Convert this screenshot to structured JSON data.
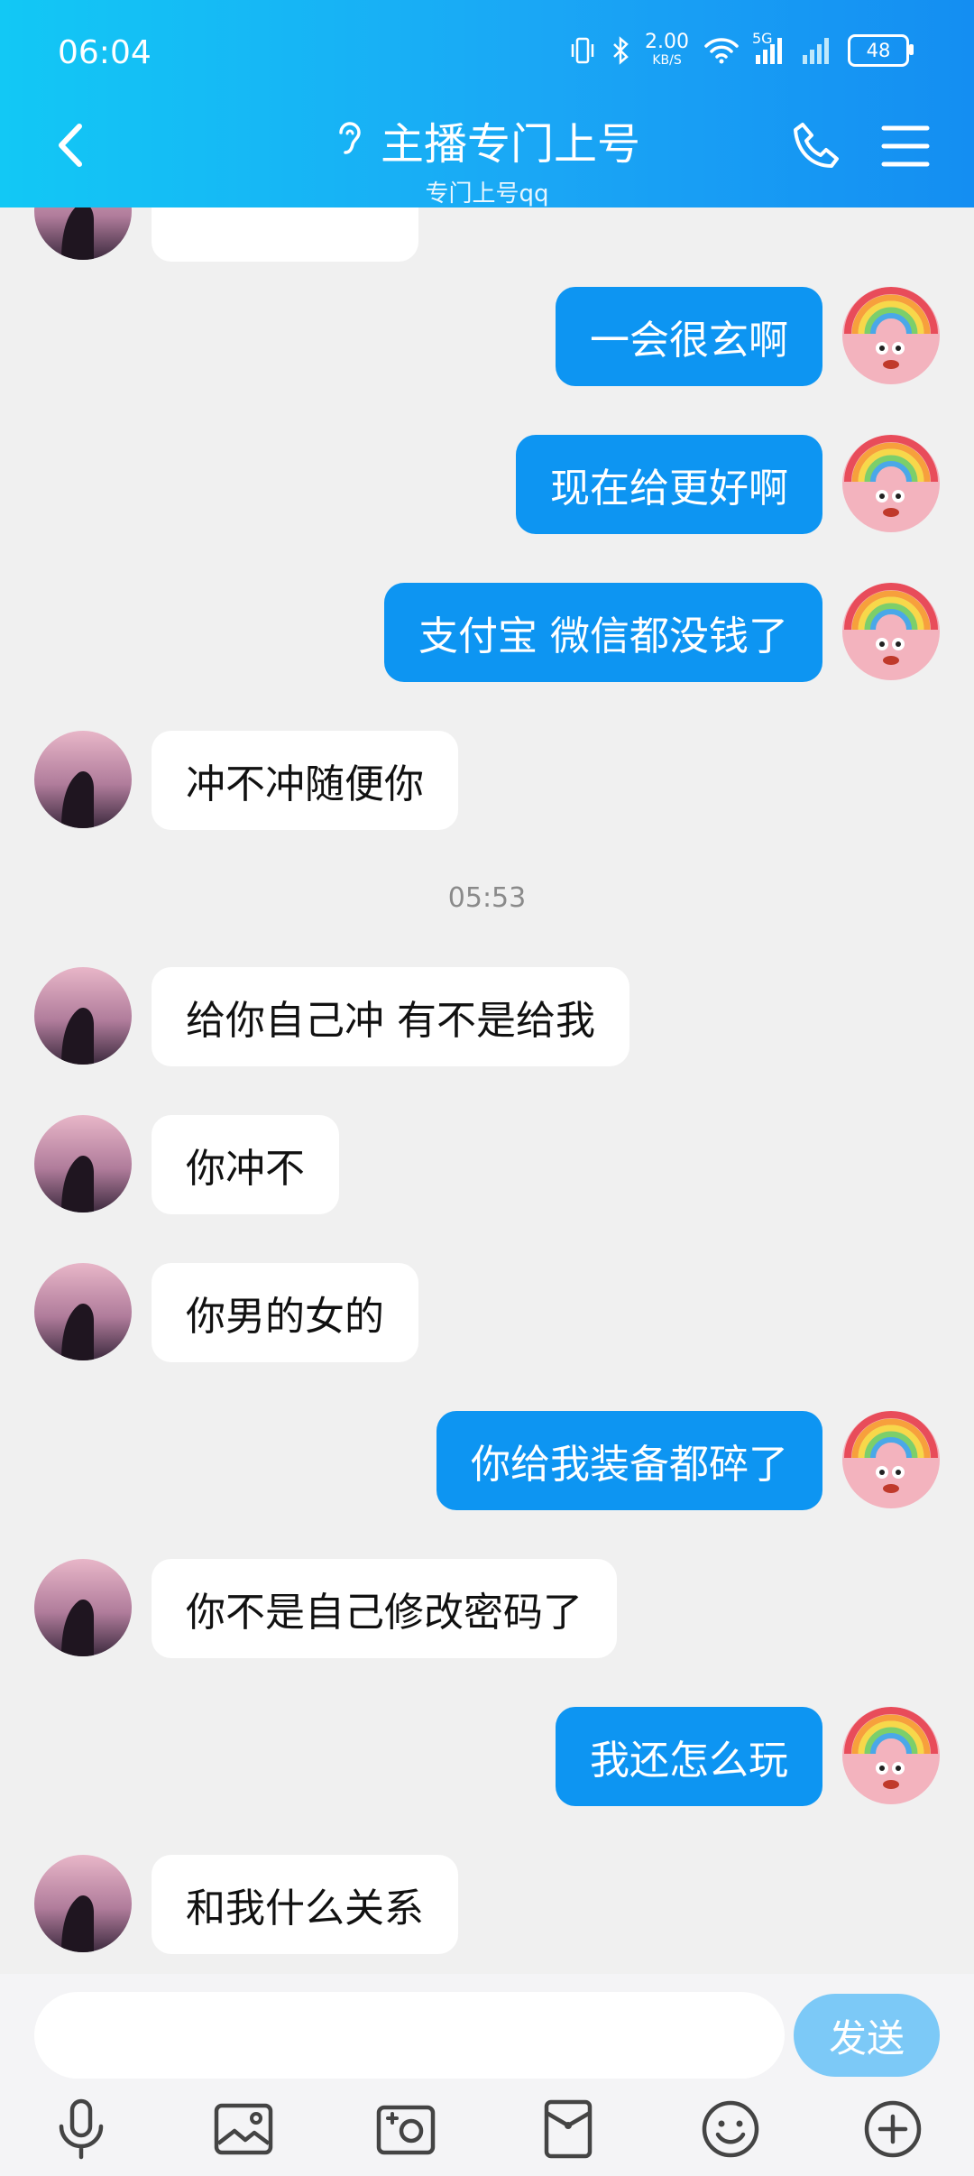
{
  "status": {
    "time": "06:04",
    "speed_value": "2.00",
    "speed_unit": "KB/S",
    "network": "5G",
    "battery": "48"
  },
  "header": {
    "title": "主播专门上号",
    "subtitle": "专门上号qq"
  },
  "messages": [
    {
      "side": "left",
      "text": "",
      "partial": true
    },
    {
      "side": "right",
      "text": "一会很玄啊"
    },
    {
      "side": "right",
      "text": "现在给更好啊"
    },
    {
      "side": "right",
      "text": "支付宝 微信都没钱了"
    },
    {
      "side": "left",
      "text": "冲不冲随便你"
    },
    {
      "side": "left",
      "text": "给你自己冲 有不是给我"
    },
    {
      "side": "left",
      "text": "你冲不"
    },
    {
      "side": "left",
      "text": "你男的女的"
    },
    {
      "side": "right",
      "text": "你给我装备都碎了"
    },
    {
      "side": "left",
      "text": "你不是自己修改密码了"
    },
    {
      "side": "right",
      "text": "我还怎么玩"
    },
    {
      "side": "left",
      "text": "和我什么关系"
    }
  ],
  "time_divider": "05:53",
  "input": {
    "send_label": "发送"
  },
  "toolbar": [
    "microphone-icon",
    "image-icon",
    "camera-icon",
    "red-packet-icon",
    "emoji-icon",
    "plus-icon"
  ],
  "colors": {
    "header_start": "#12c8f5",
    "header_end": "#148ef2",
    "outgoing_bubble": "#0d95f2",
    "incoming_bubble": "#ffffff",
    "send_button": "#7cc9f7",
    "background": "#f0f0f0"
  }
}
